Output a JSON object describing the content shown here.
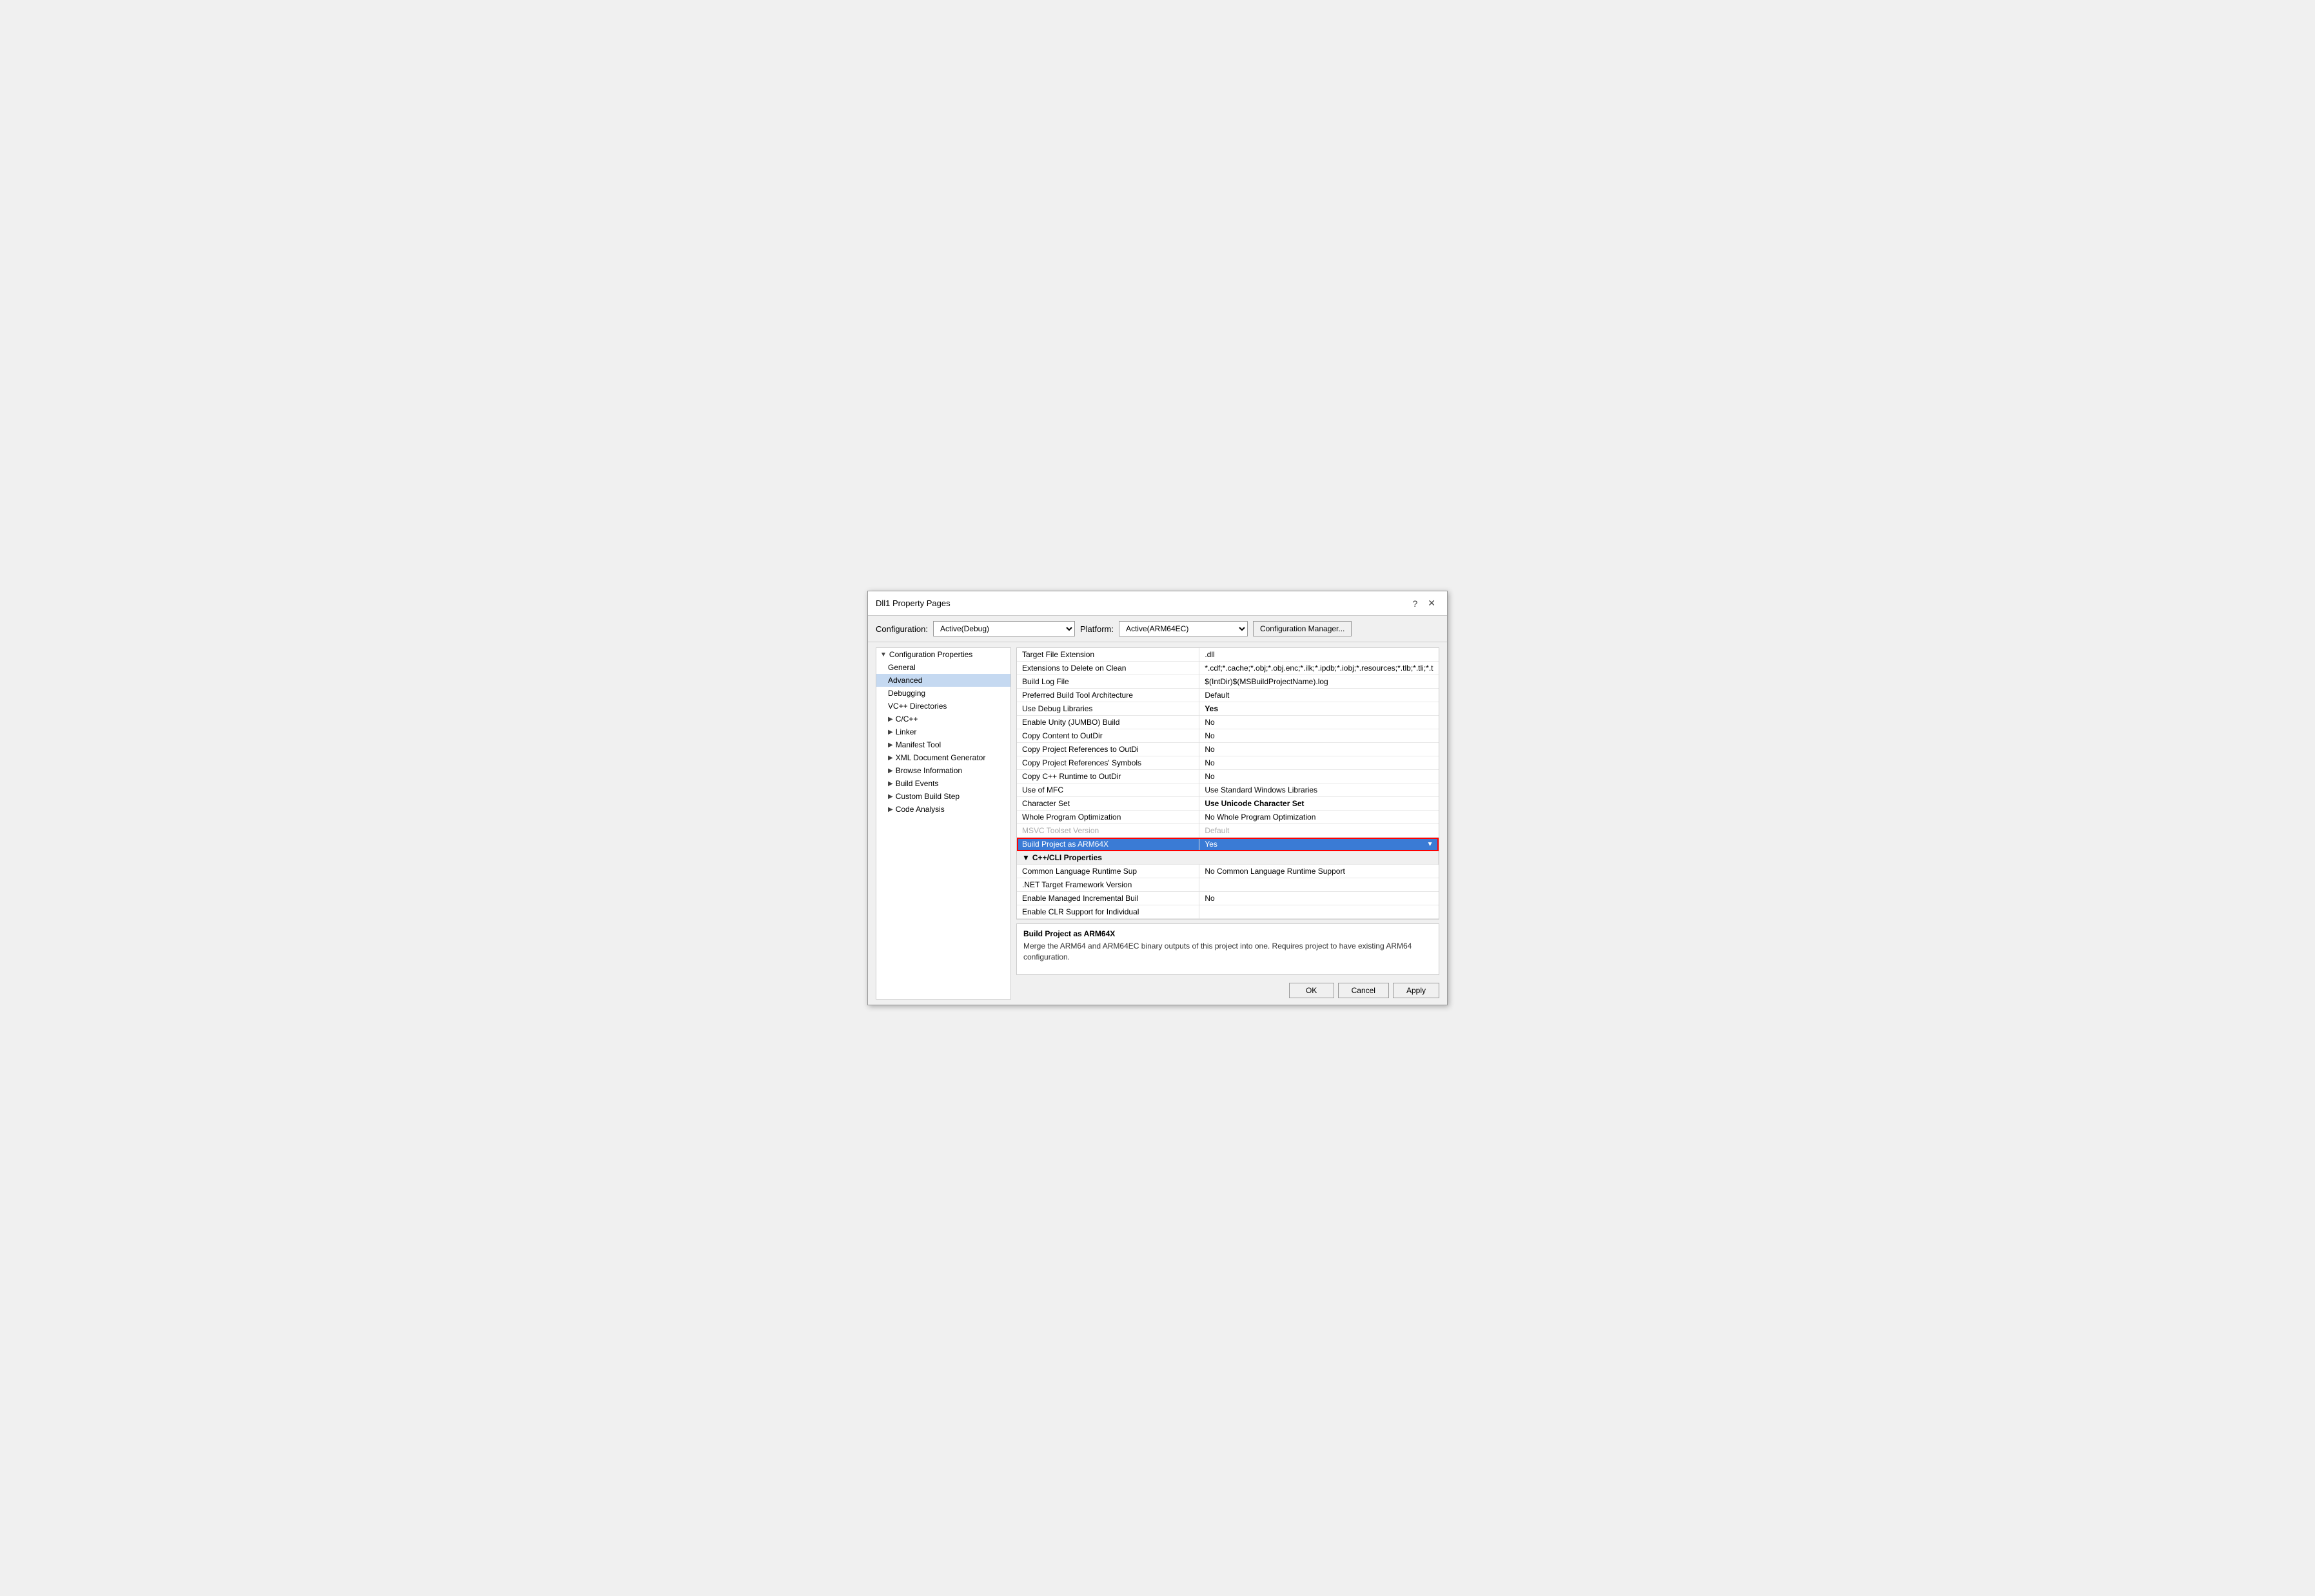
{
  "dialog": {
    "title": "Dll1 Property Pages",
    "help_btn": "?",
    "close_btn": "✕"
  },
  "config_row": {
    "config_label": "Configuration:",
    "config_value": "Active(Debug)",
    "platform_label": "Platform:",
    "platform_value": "Active(ARM64EC)",
    "manager_btn": "Configuration Manager..."
  },
  "tree": {
    "items": [
      {
        "label": "Configuration Properties",
        "level": 0,
        "expanded": true,
        "arrow": "▼"
      },
      {
        "label": "General",
        "level": 1,
        "expanded": false,
        "arrow": ""
      },
      {
        "label": "Advanced",
        "level": 1,
        "expanded": false,
        "arrow": "",
        "selected": true
      },
      {
        "label": "Debugging",
        "level": 1,
        "expanded": false,
        "arrow": ""
      },
      {
        "label": "VC++ Directories",
        "level": 1,
        "expanded": false,
        "arrow": ""
      },
      {
        "label": "C/C++",
        "level": 1,
        "expanded": false,
        "arrow": "▶"
      },
      {
        "label": "Linker",
        "level": 1,
        "expanded": false,
        "arrow": "▶"
      },
      {
        "label": "Manifest Tool",
        "level": 1,
        "expanded": false,
        "arrow": "▶"
      },
      {
        "label": "XML Document Generator",
        "level": 1,
        "expanded": false,
        "arrow": "▶"
      },
      {
        "label": "Browse Information",
        "level": 1,
        "expanded": false,
        "arrow": "▶"
      },
      {
        "label": "Build Events",
        "level": 1,
        "expanded": false,
        "arrow": "▶"
      },
      {
        "label": "Custom Build Step",
        "level": 1,
        "expanded": false,
        "arrow": "▶"
      },
      {
        "label": "Code Analysis",
        "level": 1,
        "expanded": false,
        "arrow": "▶"
      }
    ]
  },
  "properties": [
    {
      "name": "Target File Extension",
      "value": ".dll",
      "bold": false
    },
    {
      "name": "Extensions to Delete on Clean",
      "value": "*.cdf;*.cache;*.obj;*.obj.enc;*.ilk;*.ipdb;*.iobj;*.resources;*.tlb;*.tli;*.t",
      "bold": false
    },
    {
      "name": "Build Log File",
      "value": "$(IntDir)$(MSBuildProjectName).log",
      "bold": false
    },
    {
      "name": "Preferred Build Tool Architecture",
      "value": "Default",
      "bold": false
    },
    {
      "name": "Use Debug Libraries",
      "value": "Yes",
      "bold": true
    },
    {
      "name": "Enable Unity (JUMBO) Build",
      "value": "No",
      "bold": false
    },
    {
      "name": "Copy Content to OutDir",
      "value": "No",
      "bold": false
    },
    {
      "name": "Copy Project References to OutDi",
      "value": "No",
      "bold": false
    },
    {
      "name": "Copy Project References' Symbols",
      "value": "No",
      "bold": false
    },
    {
      "name": "Copy C++ Runtime to OutDir",
      "value": "No",
      "bold": false
    },
    {
      "name": "Use of MFC",
      "value": "Use Standard Windows Libraries",
      "bold": false
    },
    {
      "name": "Character Set",
      "value": "Use Unicode Character Set",
      "bold": true
    },
    {
      "name": "Whole Program Optimization",
      "value": "No Whole Program Optimization",
      "bold": false
    },
    {
      "name": "MSVC Toolset Version",
      "value": "Default",
      "bold": false,
      "faded": true
    },
    {
      "name": "Build Project as ARM64X",
      "value": "Yes",
      "bold": false,
      "highlighted": true,
      "dropdown": true
    },
    {
      "name": "C++/CLI Properties",
      "value": "",
      "bold": false,
      "section": true
    }
  ],
  "clr_properties": [
    {
      "name": "Common Language Runtime Sup",
      "value": "No Common Language Runtime Support",
      "bold": false
    },
    {
      "name": ".NET Target Framework Version",
      "value": "",
      "bold": false
    },
    {
      "name": "Enable Managed Incremental Buil",
      "value": "No",
      "bold": false
    },
    {
      "name": "Enable CLR Support for Individual",
      "value": "",
      "bold": false
    }
  ],
  "description": {
    "title": "Build Project as ARM64X",
    "text": "Merge the ARM64 and ARM64EC binary outputs of this project into one. Requires project to have existing ARM64 configuration."
  },
  "buttons": {
    "ok": "OK",
    "cancel": "Cancel",
    "apply": "Apply"
  }
}
